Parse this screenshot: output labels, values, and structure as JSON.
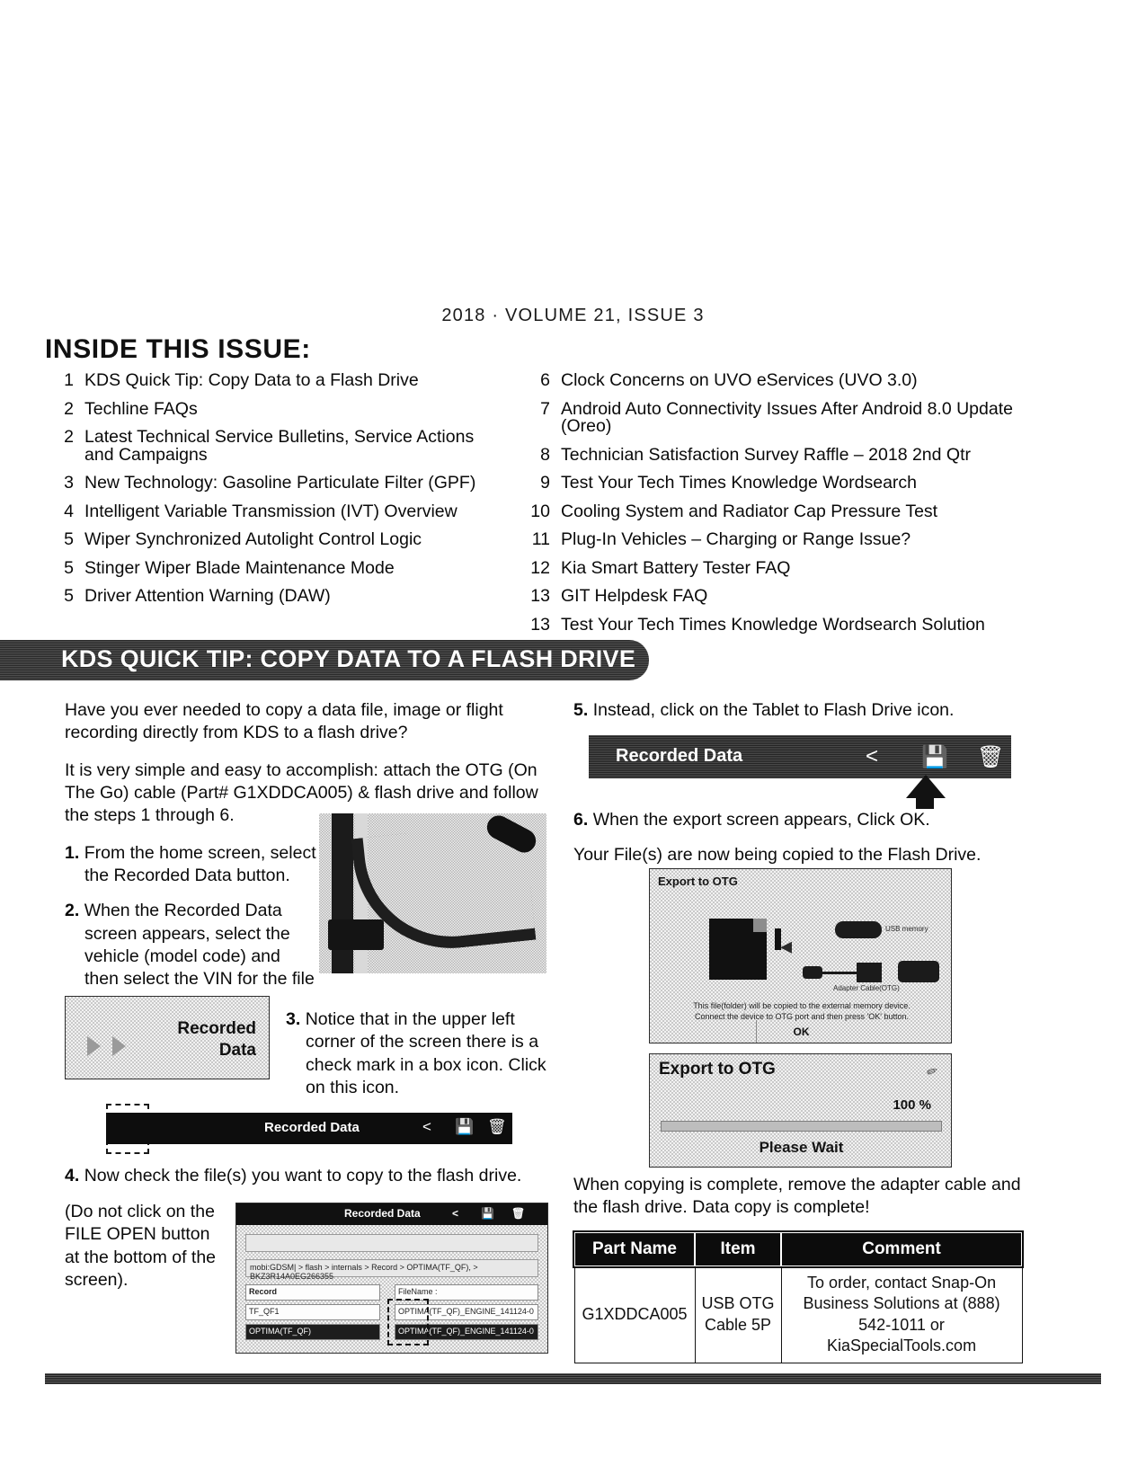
{
  "issue": {
    "line": "2018  ·  VOLUME 21, ISSUE 3"
  },
  "toc": {
    "heading": "INSIDE THIS ISSUE:",
    "left": [
      {
        "page": "1",
        "title": "KDS Quick Tip: Copy Data to a Flash Drive",
        "line2": ""
      },
      {
        "page": "2",
        "title": "Techline FAQs",
        "line2": ""
      },
      {
        "page": "2",
        "title": "Latest Technical Service Bulletins, Service Actions",
        "line2": "and Campaigns"
      },
      {
        "page": "3",
        "title": "New Technology: Gasoline Particulate Filter (GPF)",
        "line2": ""
      },
      {
        "page": "4",
        "title": "Intelligent Variable Transmission (IVT) Overview",
        "line2": ""
      },
      {
        "page": "5",
        "title": "Wiper Synchronized Autolight Control Logic",
        "line2": ""
      },
      {
        "page": "5",
        "title": "Stinger Wiper Blade Maintenance Mode",
        "line2": ""
      },
      {
        "page": "5",
        "title": "Driver Attention Warning (DAW)",
        "line2": ""
      }
    ],
    "right": [
      {
        "page": "6",
        "title": "Clock Concerns on UVO eServices (UVO 3.0)",
        "line2": ""
      },
      {
        "page": "7",
        "title": "Android Auto Connectivity Issues After Android 8.0 Update (Oreo)",
        "line2": ""
      },
      {
        "page": "8",
        "title": "Technician Satisfaction Survey Raffle – 2018 2nd Qtr",
        "line2": ""
      },
      {
        "page": "9",
        "title": "Test Your Tech Times Knowledge Wordsearch",
        "line2": ""
      },
      {
        "page": "10",
        "title": "Cooling System and Radiator Cap Pressure Test",
        "line2": ""
      },
      {
        "page": "11",
        "title": "Plug-In Vehicles – Charging or Range Issue?",
        "line2": ""
      },
      {
        "page": "12",
        "title": "Kia Smart Battery Tester FAQ",
        "line2": ""
      },
      {
        "page": "13",
        "title": "GIT Helpdesk FAQ",
        "line2": ""
      },
      {
        "page": "13",
        "title": "Test Your Tech Times Knowledge Wordsearch Solution",
        "line2": ""
      }
    ]
  },
  "article": {
    "banner_title": "KDS QUICK TIP: COPY DATA TO A FLASH DRIVE",
    "intro1": "Have you ever needed to copy a data file, image or flight recording directly from KDS to a flash drive?",
    "intro2": "It is very simple and easy to accomplish: attach the OTG (On The Go) cable (Part# G1XDDCA005) & flash drive and follow the steps 1 through 6.",
    "step1_num": "1.",
    "step1": "From the home screen, select the Recorded Data button.",
    "step2_num": "2.",
    "step2": "When the Recorded Data screen appears, select the vehicle (model code) and then select the VIN for the file you want to copy.",
    "step3_num": "3.",
    "step3": "Notice that in the upper left corner of the screen there is a check mark in a box icon. Click on this icon.",
    "step4_num": "4.",
    "step4": "Now check the file(s) you want to copy to the flash drive.",
    "step4_note": "(Do not click on the FILE OPEN button at the bottom of the screen).",
    "step5_num": "5.",
    "step5": "Instead, click on the Tablet to Flash Drive icon.",
    "step6_num": "6.",
    "step6": "When the export screen appears, Click OK.",
    "step6_note": "Your File(s) are now being copied to the Flash Drive.",
    "closing": "When copying is complete, remove the adapter cable and the flash drive. Data copy is complete!"
  },
  "figures": {
    "recorded_button_line1": "Recorded",
    "recorded_button_line2": "Data",
    "toolbar_small_title": "Recorded Data",
    "toolbar_big_title": "Recorded Data",
    "share_icon": "share-icon",
    "tablet_to_flash_icon": "tablet-to-flash-drive-icon",
    "trash_icon": "trash-icon",
    "otg_dialog_title": "Export to OTG",
    "otg_dialog_msg_line1": "This file(folder) will be copied to the external memory device.",
    "otg_dialog_msg_line2": "Connect the device to OTG port and then press 'OK' button.",
    "otg_dialog_ok": "OK",
    "otg_label_usb_memory": "USB memory",
    "otg_label_otg_cable": "Adapter Cable(OTG)",
    "otg_progress_title": "Export to OTG",
    "otg_progress_pct": "100 %",
    "otg_progress_status": "Please Wait",
    "filelist_title": "Recorded Data",
    "filelist_path": "mobi:GDSM| > flash > internals > Record > OPTIMA(TF_QF), > BKZ3R14A0EG266355",
    "filelist_col_record": "Record",
    "filelist_col_filename": "FileName :",
    "filelist_row1_left": "TF_QF1",
    "filelist_row1_right": "OPTIMA(TF_QF)_ENGINE_141124-0",
    "filelist_row2_left": "OPTIMA(TF_QF)",
    "filelist_row2_right": "OPTIMA(TF_QF)_ENGINE_141124-0"
  },
  "parts_table": {
    "columns": [
      "Part Name",
      "Item",
      "Comment"
    ],
    "rows": [
      {
        "part_name": "G1XDDCA005",
        "item": "USB OTG Cable 5P",
        "comment": "To order, contact Snap-On Business Solutions at (888) 542-1011 or KiaSpecialTools.com"
      }
    ]
  }
}
